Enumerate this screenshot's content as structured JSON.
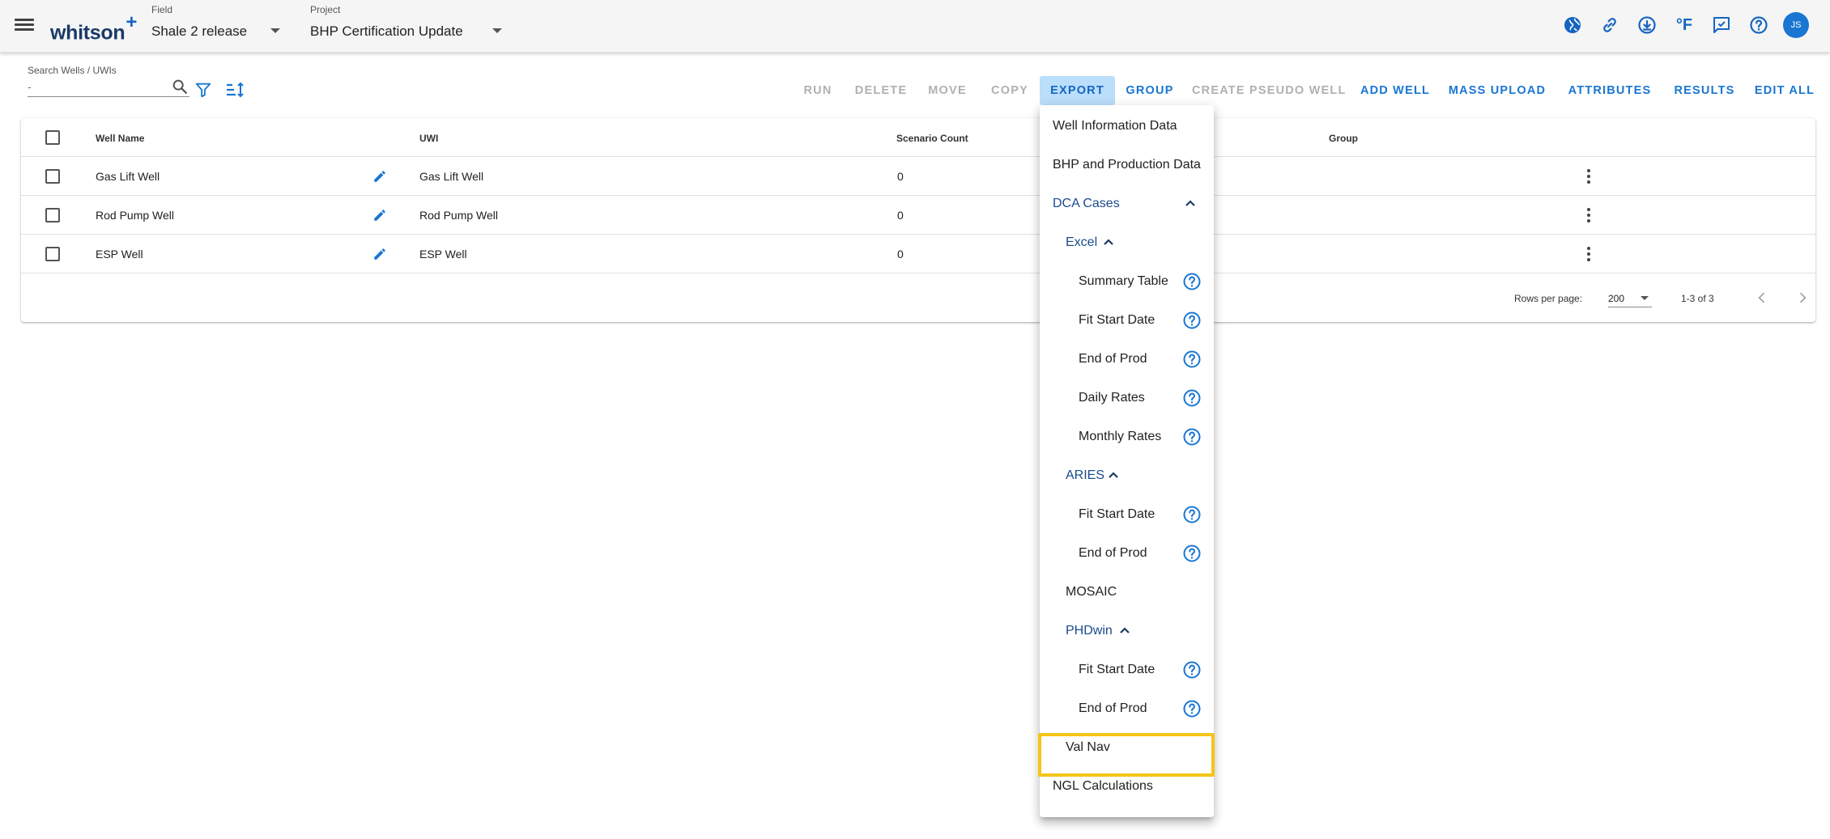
{
  "app": {
    "logo_text": "whitson",
    "logo_plus": "+",
    "field_label": "Field",
    "field_value": "Shale 2 release",
    "project_label": "Project",
    "project_value": "BHP Certification Update",
    "avatar_initials": "JS",
    "temperature_unit": "°F",
    "top_icons": [
      "globe-icon",
      "link-icon",
      "download-icon",
      "temperature-unit-icon",
      "feedback-icon",
      "help-icon",
      "avatar"
    ]
  },
  "search": {
    "label": "Search Wells / UWIs",
    "placeholder": "-",
    "value": ""
  },
  "toolbar": {
    "run": "RUN",
    "delete": "DELETE",
    "move": "MOVE",
    "copy": "COPY",
    "export": "EXPORT",
    "group": "GROUP",
    "create_pseudo_well": "CREATE PSEUDO WELL",
    "add_well": "ADD WELL",
    "mass_upload": "MASS UPLOAD",
    "attributes": "ATTRIBUTES",
    "results": "RESULTS",
    "edit_all": "EDIT ALL"
  },
  "table": {
    "columns": {
      "well_name": "Well Name",
      "uwi": "UWI",
      "scenario_count": "Scenario Count",
      "group": "Group"
    },
    "rows": [
      {
        "well_name": "Gas Lift Well",
        "uwi": "Gas Lift Well",
        "scenario_count": "0"
      },
      {
        "well_name": "Rod Pump Well",
        "uwi": "Rod Pump Well",
        "scenario_count": "0"
      },
      {
        "well_name": "ESP Well",
        "uwi": "ESP Well",
        "scenario_count": "0"
      }
    ],
    "footer": {
      "rows_per_page_label": "Rows per page:",
      "rows_per_page_value": "200",
      "range": "1-3 of 3"
    }
  },
  "export_menu": {
    "well_information_data": "Well Information Data",
    "bhp_and_production_data": "BHP and Production Data",
    "dca_cases": "DCA Cases",
    "excel": {
      "label": "Excel",
      "items": [
        "Summary Table",
        "Fit Start Date",
        "End of Prod",
        "Daily Rates",
        "Monthly Rates"
      ]
    },
    "aries": {
      "label": "ARIES",
      "items": [
        "Fit Start Date",
        "End of Prod"
      ]
    },
    "mosaic": "MOSAIC",
    "phdwin": {
      "label": "PHDwin",
      "items": [
        "Fit Start Date",
        "End of Prod"
      ]
    },
    "val_nav": "Val Nav",
    "ngl_calculations": "NGL Calculations",
    "highlighted_item": "Val Nav"
  },
  "colors": {
    "accent": "#1976d2",
    "menu_section_text": "#1a4b8c",
    "active_button_bg": "#bbdefb",
    "highlight_border": "#f5c518",
    "disabled_text": "#b0b0b0"
  }
}
